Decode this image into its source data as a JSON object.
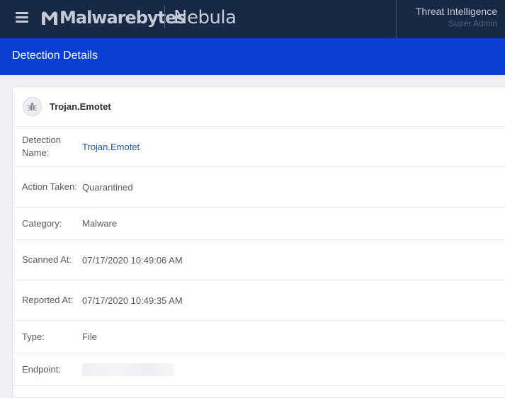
{
  "header": {
    "brand": "Malwarebytes",
    "product": "Nebula",
    "account_name": "Threat Intelligence",
    "account_role": "Super Admin"
  },
  "page": {
    "title": "Detection Details"
  },
  "detection": {
    "heading": "Trojan.Emotet",
    "rows": [
      {
        "label": "Detection Name:",
        "value": "Trojan.Emotet"
      },
      {
        "label": "Action Taken:",
        "value": "Quarantined"
      },
      {
        "label": "Category:",
        "value": "Malware"
      },
      {
        "label": "Scanned At:",
        "value": "07/17/2020 10:49:06 AM"
      },
      {
        "label": "Reported At:",
        "value": "07/17/2020 10:49:35 AM"
      },
      {
        "label": "Type:",
        "value": "File"
      },
      {
        "label": "Endpoint:",
        "value": ""
      }
    ]
  },
  "icons": {
    "menu": "hamburger-menu-icon",
    "brand": "malwarebytes-logo-icon",
    "threat": "bug-icon"
  },
  "colors": {
    "nav_bg": "#172944",
    "title_bg": "#0a3fd4",
    "link": "#1d55b5"
  }
}
